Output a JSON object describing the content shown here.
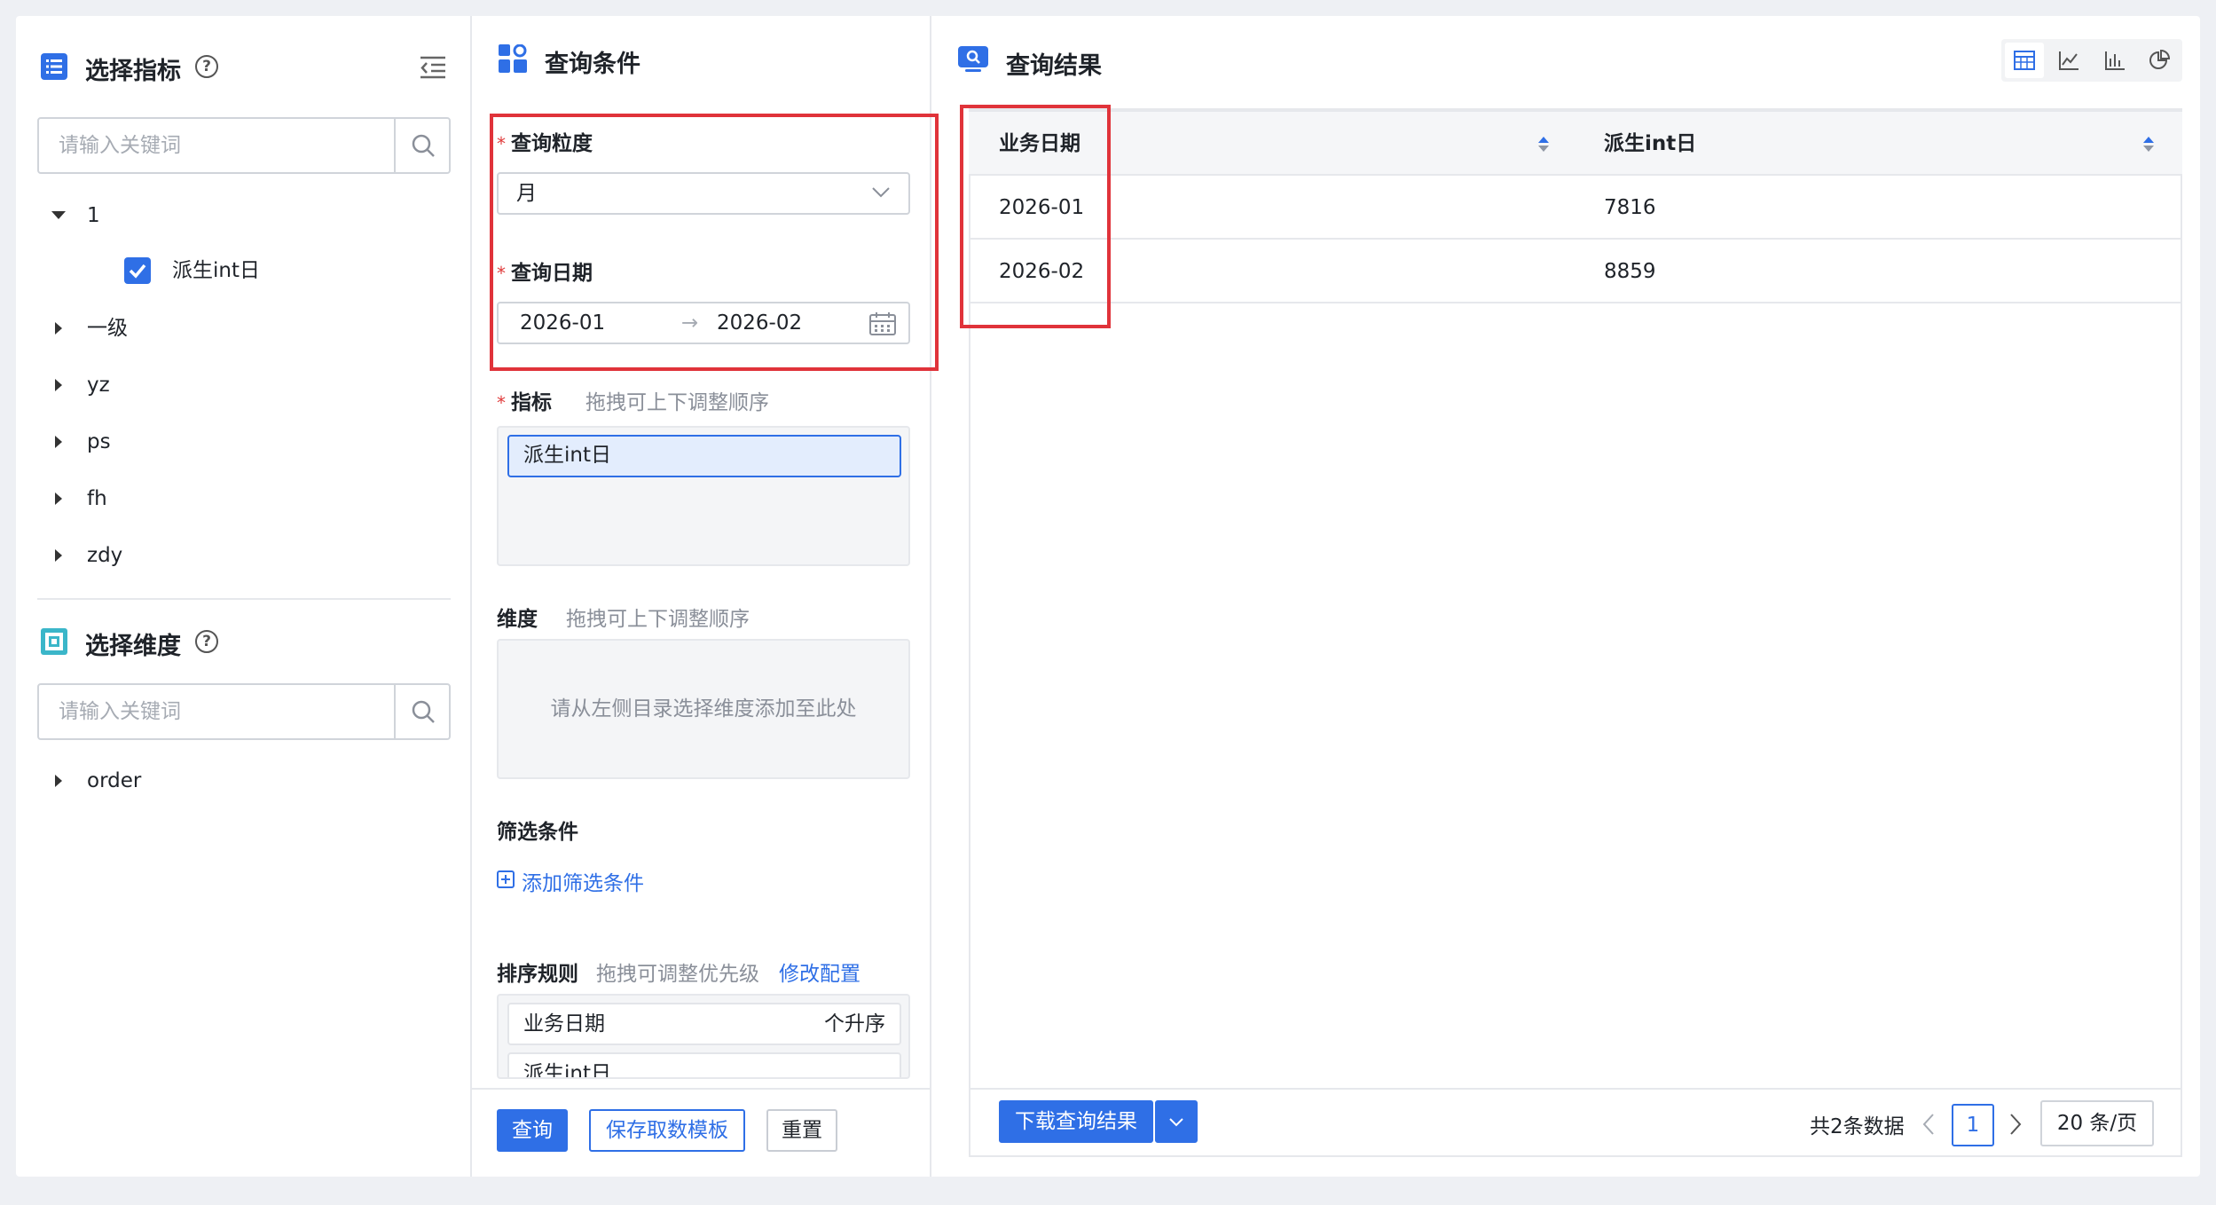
{
  "left_panel": {
    "metrics_title": "选择指标",
    "metrics_search_placeholder": "请输入关键词",
    "metrics_tree": [
      {
        "label": "1",
        "expanded": true,
        "children": [
          {
            "label": "派生int日",
            "checked": true
          }
        ]
      },
      {
        "label": "一级",
        "expanded": false
      },
      {
        "label": "yz",
        "expanded": false
      },
      {
        "label": "ps",
        "expanded": false
      },
      {
        "label": "fh",
        "expanded": false
      },
      {
        "label": "zdy",
        "expanded": false
      }
    ],
    "dimensions_title": "选择维度",
    "dimensions_search_placeholder": "请输入关键词",
    "dimensions_tree": [
      {
        "label": "order",
        "expanded": false
      }
    ]
  },
  "mid_panel": {
    "title": "查询条件",
    "granularity_label": "查询粒度",
    "granularity_value": "月",
    "date_label": "查询日期",
    "date_start": "2026-01",
    "date_end": "2026-02",
    "metrics_label": "指标",
    "metrics_hint": "拖拽可上下调整顺序",
    "selected_metrics": [
      "派生int日"
    ],
    "dimensions_label": "维度",
    "dimensions_hint": "拖拽可上下调整顺序",
    "dimensions_empty": "请从左侧目录选择维度添加至此处",
    "filter_label": "筛选条件",
    "add_filter_label": "添加筛选条件",
    "sort_label": "排序规则",
    "sort_hint": "拖拽可调整优先级",
    "sort_edit_link": "修改配置",
    "sort_rules": [
      {
        "field": "业务日期",
        "order": "个升序"
      },
      {
        "field": "派生int日",
        "order": ""
      }
    ],
    "buttons": {
      "query": "查询",
      "save_template": "保存取数模板",
      "reset": "重置"
    }
  },
  "right_panel": {
    "title": "查询结果",
    "view_modes": [
      {
        "icon": "table-icon",
        "active": true
      },
      {
        "icon": "line-chart-icon",
        "active": false
      },
      {
        "icon": "bar-chart-icon",
        "active": false
      },
      {
        "icon": "pie-chart-icon",
        "active": false
      }
    ],
    "table": {
      "columns": [
        "业务日期",
        "派生int日"
      ],
      "rows": [
        [
          "2026-01",
          "7816"
        ],
        [
          "2026-02",
          "8859"
        ]
      ]
    },
    "download_label": "下载查询结果",
    "pager": {
      "total_prefix": "共",
      "total_count": "2",
      "total_suffix": "条数据",
      "current_page": "1",
      "page_size": "20 条/页"
    }
  },
  "colors": {
    "accent": "#2f6fe6",
    "highlight_box": "#e0333a",
    "required_star": "#e03c3c"
  }
}
